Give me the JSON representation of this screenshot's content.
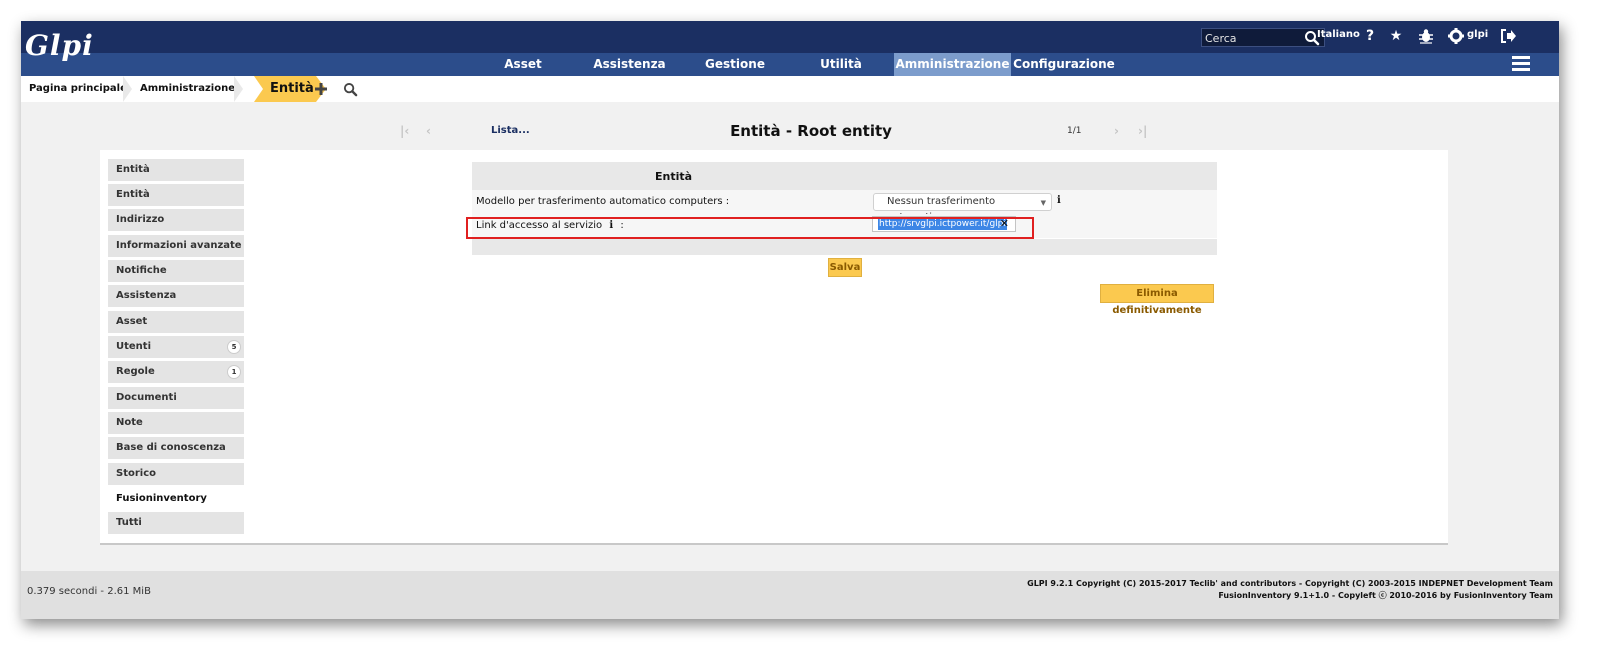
{
  "header": {
    "logo_text": "Glpi",
    "search": {
      "placeholder": "Cerca"
    },
    "language": "Italiano",
    "user": "glpi",
    "icons": [
      "search-icon",
      "help-icon",
      "star-icon",
      "bug-icon",
      "gear-icon",
      "logout-icon"
    ]
  },
  "nav": {
    "items": [
      {
        "label": "Asset"
      },
      {
        "label": "Assistenza"
      },
      {
        "label": "Gestione"
      },
      {
        "label": "Utilità"
      },
      {
        "label": "Amministrazione",
        "active": true
      },
      {
        "label": "Configurazione"
      }
    ],
    "menu_icon": "hamburger-icon"
  },
  "breadcrumb": {
    "items": [
      {
        "label": "Pagina principale"
      },
      {
        "label": "Amministrazione"
      },
      {
        "label": "Entità",
        "current": true
      }
    ],
    "add_icon": "plus-icon",
    "search_icon": "search-icon"
  },
  "record_nav": {
    "list_label": "Lista...",
    "title": "Entità - Root entity",
    "count": "1/1"
  },
  "tabs": [
    {
      "label": "Entità"
    },
    {
      "label": "Entità"
    },
    {
      "label": "Indirizzo"
    },
    {
      "label": "Informazioni avanzate"
    },
    {
      "label": "Notifiche"
    },
    {
      "label": "Assistenza"
    },
    {
      "label": "Asset"
    },
    {
      "label": "Utenti",
      "badge": "5"
    },
    {
      "label": "Regole",
      "badge": "1"
    },
    {
      "label": "Documenti"
    },
    {
      "label": "Note"
    },
    {
      "label": "Base di conoscenza"
    },
    {
      "label": "Storico"
    },
    {
      "label": "Fusioninventory",
      "active": true
    },
    {
      "label": "Tutti"
    }
  ],
  "form": {
    "title": "Entità",
    "transfer_label": "Modello per trasferimento automatico computers :",
    "transfer_value": "Nessun trasferimento automatico",
    "link_label": "Link d'accesso al servizio",
    "link_colon": ":",
    "link_value": "http://srvglpi.ictpower.it/glpi",
    "save_label": "Salva",
    "purge_label": "Elimina definitivamente"
  },
  "footer": {
    "timing": "0.379 secondi - 2.61 MiB",
    "copyright_line1": "GLPI 9.2.1 Copyright (C) 2015-2017 Teclib' and contributors - Copyright (C) 2003-2015 INDEPNET Development Team",
    "copyright_line2": "FusionInventory 9.1+1.0 - Copyleft ⓒ 2010-2016 by FusionInventory Team"
  },
  "colors": {
    "header_bg": "#1b2f62",
    "nav_bg": "#2c4d8b",
    "nav_active_bg": "#7c9ccc",
    "accent_yellow": "#fbc94f",
    "highlight_red": "#e02020"
  }
}
